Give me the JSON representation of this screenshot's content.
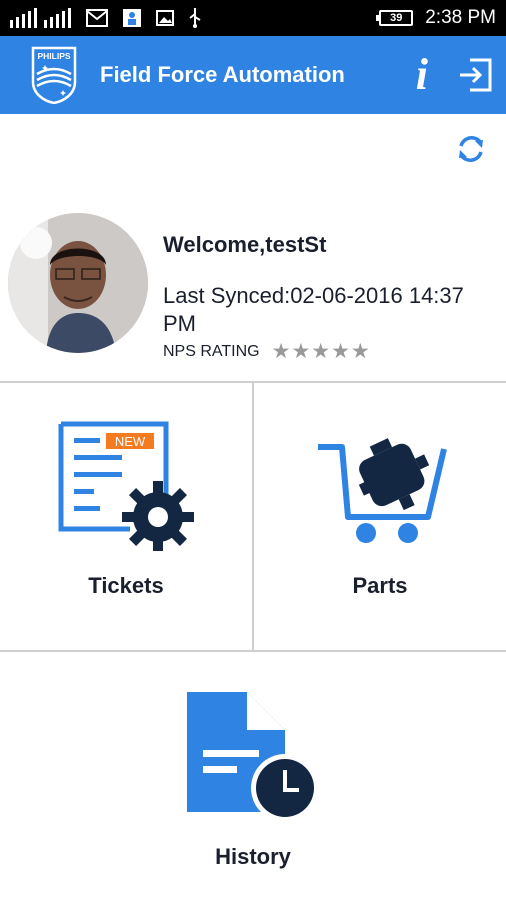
{
  "status_bar": {
    "time": "2:38 PM",
    "battery": "39"
  },
  "app_bar": {
    "title": "Field Force Automation",
    "logo_text": "PHILIPS"
  },
  "profile": {
    "welcome": "Welcome,testSt",
    "last_synced": "Last Synced:02-06-2016 14:37 PM",
    "nps_label": "NPS RATING",
    "nps_stars_filled": 0,
    "nps_stars_total": 5
  },
  "tiles": {
    "tickets": {
      "label": "Tickets",
      "badge": "NEW"
    },
    "parts": {
      "label": "Parts"
    },
    "history": {
      "label": "History"
    }
  },
  "colors": {
    "primary": "#2f83e3",
    "dark": "#132743",
    "divider": "#cfcfcf"
  }
}
